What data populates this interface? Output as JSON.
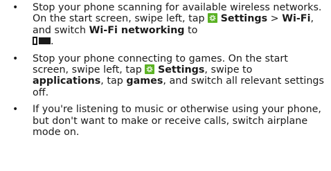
{
  "tips": [
    {
      "t1": "Stop your phone scanning for available wireless networks. On the start screen, swipe left, tap ",
      "t2": "Settings",
      "t3": " > ",
      "t4": "Wi-Fi",
      "t5": ", and switch ",
      "t6": "Wi-Fi networking",
      "t7": " to ",
      "t8": "."
    },
    {
      "t1": "Stop your phone connecting to games. On the start screen, swipe left, tap ",
      "t2": "Settings",
      "t3": ", swipe to ",
      "t4": "applications",
      "t5": ", tap ",
      "t6": "games",
      "t7": ", and switch all relevant settings off."
    },
    {
      "t1": "If you're listening to music or otherwise using your phone, but don't want to make or receive calls, switch airplane mode on."
    }
  ],
  "bullet": "•",
  "icons": {
    "settings": "settings-gear-icon",
    "settings_color": "#5bb224",
    "toggle": "toggle-off-icon"
  }
}
